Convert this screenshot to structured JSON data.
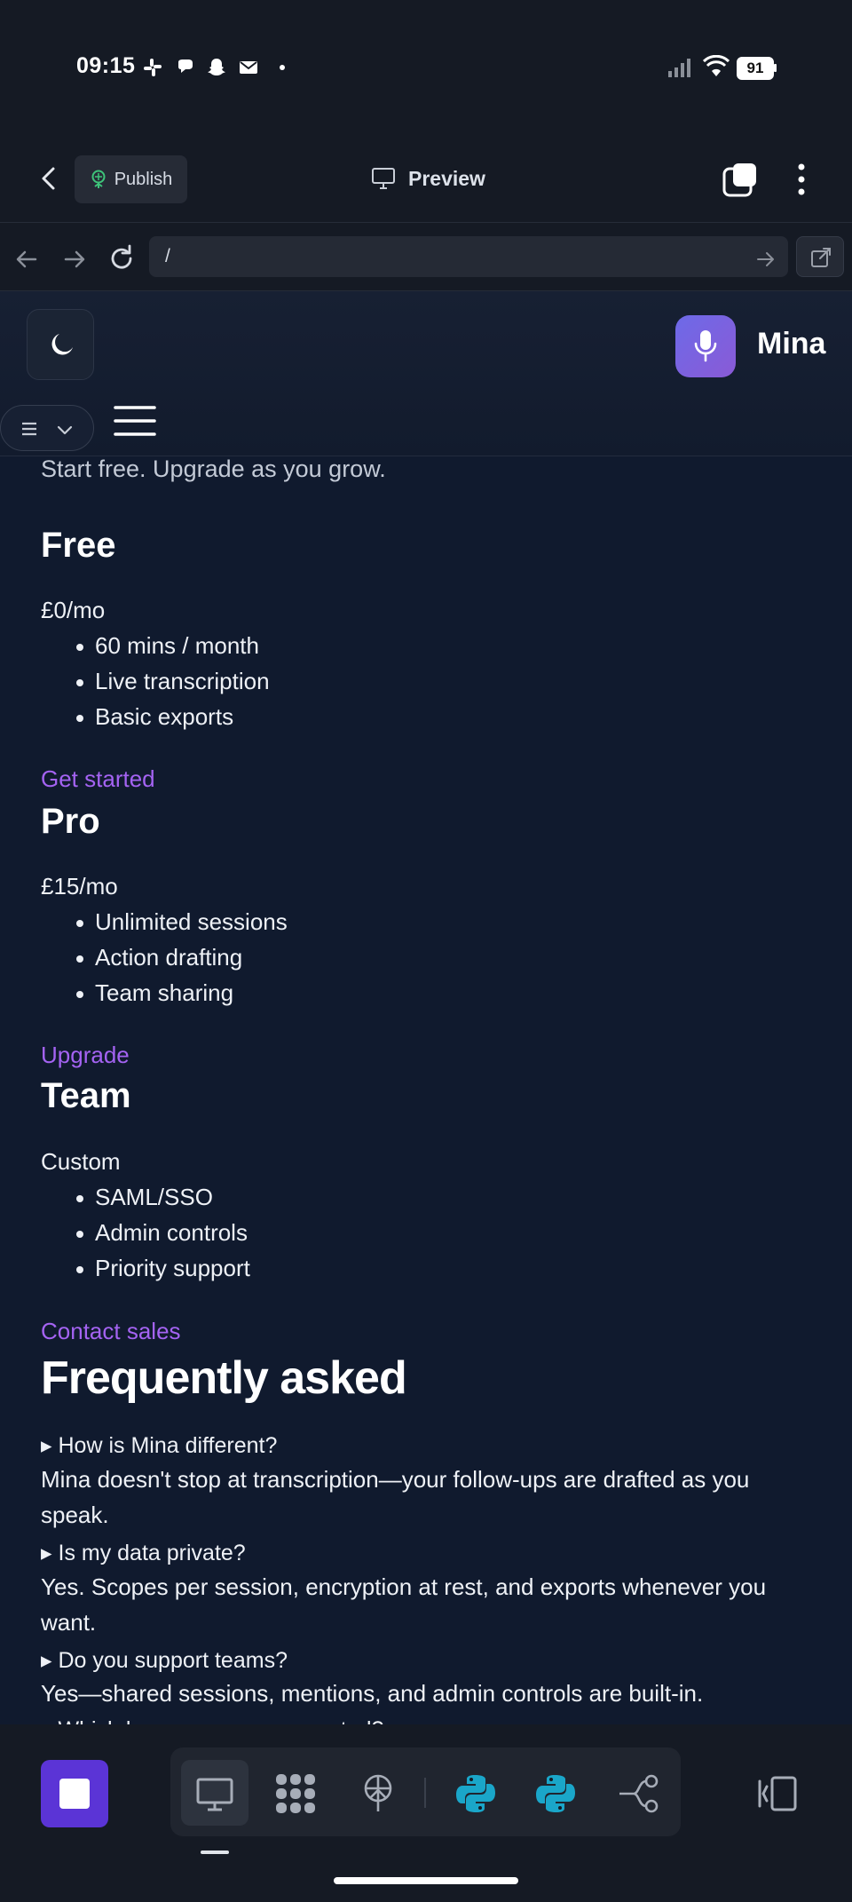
{
  "status": {
    "time": "09:15",
    "battery": "91",
    "notification_icons": [
      "slack-icon",
      "chat-bubbles-icon",
      "snapchat-icon",
      "mail-icon",
      "dot-icon"
    ]
  },
  "appbar": {
    "publish_label": "Publish",
    "preview_label": "Preview"
  },
  "browser": {
    "url": "/"
  },
  "site": {
    "brand": "Mina"
  },
  "content": {
    "tagline": "Start free. Upgrade as you grow.",
    "plans": [
      {
        "name": "Free",
        "price": "£0/mo",
        "features": [
          "60 mins / month",
          "Live transcription",
          "Basic exports"
        ],
        "cta": "Get started"
      },
      {
        "name": "Pro",
        "price": "£15/mo",
        "features": [
          "Unlimited sessions",
          "Action drafting",
          "Team sharing"
        ],
        "cta": "Upgrade"
      },
      {
        "name": "Team",
        "price": "Custom",
        "features": [
          "SAML/SSO",
          "Admin controls",
          "Priority support"
        ],
        "cta": "Contact sales"
      }
    ],
    "faq_title": "Frequently asked",
    "faq": [
      {
        "q": "▸ How is Mina different?",
        "a": "Mina doesn't stop at transcription—your follow-ups are drafted as you speak."
      },
      {
        "q": "▸ Is my data private?",
        "a": "Yes. Scopes per session, encryption at rest, and exports whenever you want."
      },
      {
        "q": "▸ Do you support teams?",
        "a": "Yes—shared sessions, mentions, and admin controls are built-in."
      },
      {
        "q": "▸ Which languages are supported?"
      }
    ]
  },
  "toolbar": {
    "tools": [
      "desktop-icon",
      "grid-icon",
      "deploy-icon",
      "python-icon",
      "python-icon",
      "connections-icon"
    ],
    "accent": "#5b34d6",
    "python_color": "#1aa6c9"
  }
}
